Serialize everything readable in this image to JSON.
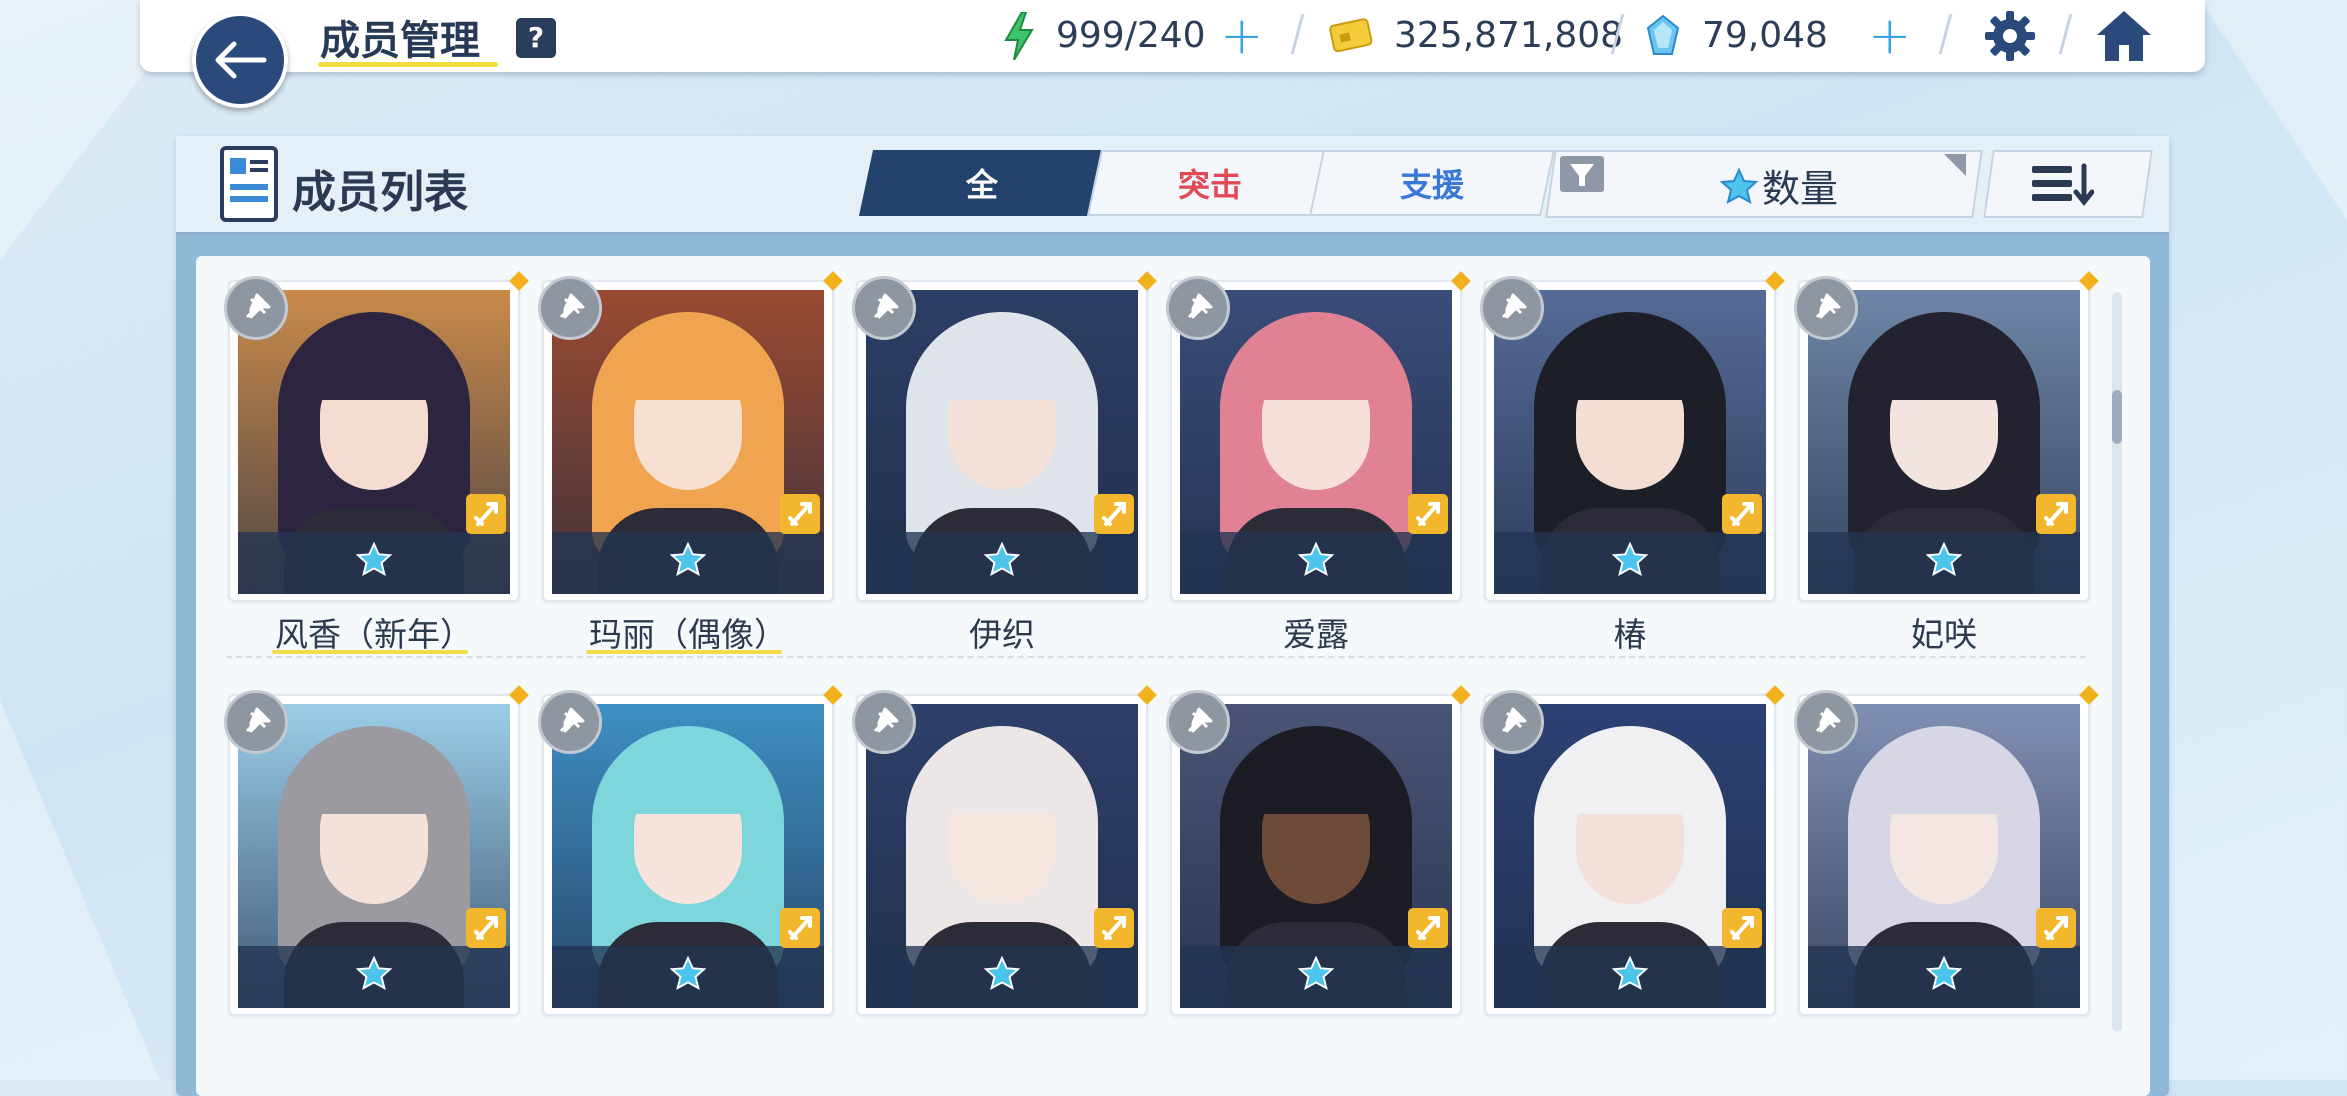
{
  "header": {
    "title": "成员管理",
    "help": "?",
    "stamina": "999/240",
    "credits": "325,871,808",
    "gems": "79,048"
  },
  "panel": {
    "list_title": "成员列表",
    "tabs": [
      "全",
      "突击",
      "支援"
    ],
    "sort_label": "数量"
  },
  "members": [
    {
      "name": "风香（新年）",
      "bg": "#c98a4a",
      "hair": "#2d2440",
      "skin": "#f4dcd0"
    },
    {
      "name": "玛丽（偶像）",
      "bg": "#9a4a30",
      "hair": "#f0a450",
      "skin": "#f7e0d2"
    },
    {
      "name": "伊织",
      "bg": "#2d3e66",
      "hair": "#dfe3ea",
      "skin": "#f3e1da"
    },
    {
      "name": "爱露",
      "bg": "#3a4c78",
      "hair": "#e08294",
      "skin": "#f6dfd6"
    },
    {
      "name": "椿",
      "bg": "#556a96",
      "hair": "#1d1f28",
      "skin": "#f4ded4"
    },
    {
      "name": "妃咲",
      "bg": "#6f86a8",
      "hair": "#22232e",
      "skin": "#f3e4e0"
    },
    {
      "name": "",
      "bg": "#9bcde8",
      "hair": "#9a9aa0",
      "skin": "#f4e2da"
    },
    {
      "name": "",
      "bg": "#3f8fc4",
      "hair": "#7cd6dc",
      "skin": "#f6e4dc"
    },
    {
      "name": "",
      "bg": "#2e3f6a",
      "hair": "#ece6e6",
      "skin": "#f6e6e0"
    },
    {
      "name": "",
      "bg": "#4a5476",
      "hair": "#1c1c24",
      "skin": "#6e4a38"
    },
    {
      "name": "",
      "bg": "#2c4274",
      "hair": "#f0f0f2",
      "skin": "#f4e0da"
    },
    {
      "name": "",
      "bg": "#8090b4",
      "hair": "#d6d6e6",
      "skin": "#f4e6e2"
    }
  ],
  "icons": [
    "back-arrow-icon",
    "help-icon",
    "energy-icon",
    "credit-card-icon",
    "gem-icon",
    "settings-gear-icon",
    "home-icon",
    "roster-list-icon",
    "filter-icon",
    "sort-order-icon",
    "pin-icon",
    "role-badge-icon",
    "star-icon"
  ],
  "colors": {
    "accent": "#23436d",
    "strike": "#e04a56",
    "support": "#3a78d8",
    "badge": "#f2b72c",
    "star": "#4cc4ec"
  }
}
